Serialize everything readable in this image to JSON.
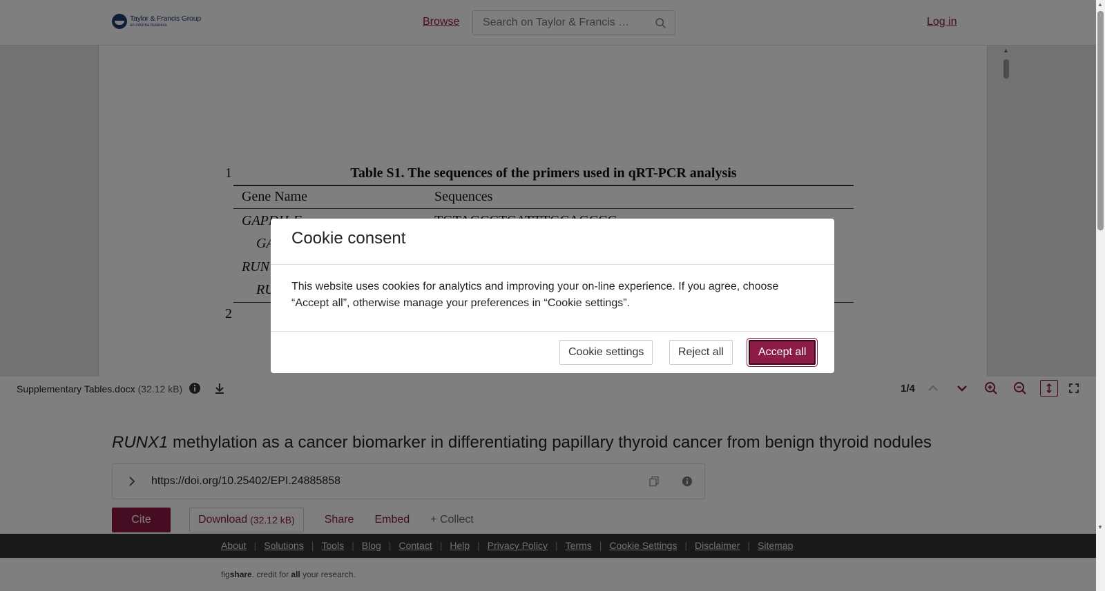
{
  "header": {
    "logo_line1": "Taylor & Francis Group",
    "logo_line2": "an informa business",
    "browse": "Browse",
    "search_placeholder": "Search on Taylor & Francis …",
    "login": "Log in"
  },
  "viewer": {
    "doc_title": "Table S1. The sequences of the primers used in qRT-PCR analysis",
    "line_numbers": [
      "1",
      "2"
    ],
    "table_headers": [
      "Gene Name",
      "Sequences"
    ],
    "gene_rows": [
      "GAPDH-F",
      "GA",
      "RUN",
      "RU"
    ],
    "sequence_first": "TGTAGCCTCATTTGCAGCCC",
    "file_name": "Supplementary Tables.docx",
    "file_size": "(32.12 kB)",
    "page_indicator": "1/4"
  },
  "article": {
    "title_italic": "RUNX1",
    "title_rest": " methylation as a cancer biomarker in differentiating papillary thyroid cancer from benign thyroid nodules",
    "doi": "https://doi.org/10.25402/EPI.24885858",
    "cite": "Cite",
    "download": "Download",
    "download_size": "(32.12 kB)",
    "share": "Share",
    "embed": "Embed",
    "collect": "+ Collect"
  },
  "footer": {
    "links": [
      "About",
      "Solutions",
      "Tools",
      "Blog",
      "Contact",
      "Help",
      "Privacy Policy",
      "Terms",
      "Cookie Settings",
      "Disclaimer",
      "Sitemap"
    ],
    "tag_pre": "fig",
    "tag_bold": "share",
    "tag_mid": ". credit for ",
    "tag_all": "all",
    "tag_post": " your research."
  },
  "cookie": {
    "title": "Cookie consent",
    "body": "This website uses cookies for analytics and improving your on-line experience. If you agree, choose “Accept all”, otherwise manage your preferences in “Cookie settings”.",
    "settings": "Cookie settings",
    "reject": "Reject all",
    "accept": "Accept all"
  },
  "colors": {
    "accent": "#8c1b45",
    "brand_navy": "#1f3a6e",
    "footer_bg": "#333333"
  }
}
